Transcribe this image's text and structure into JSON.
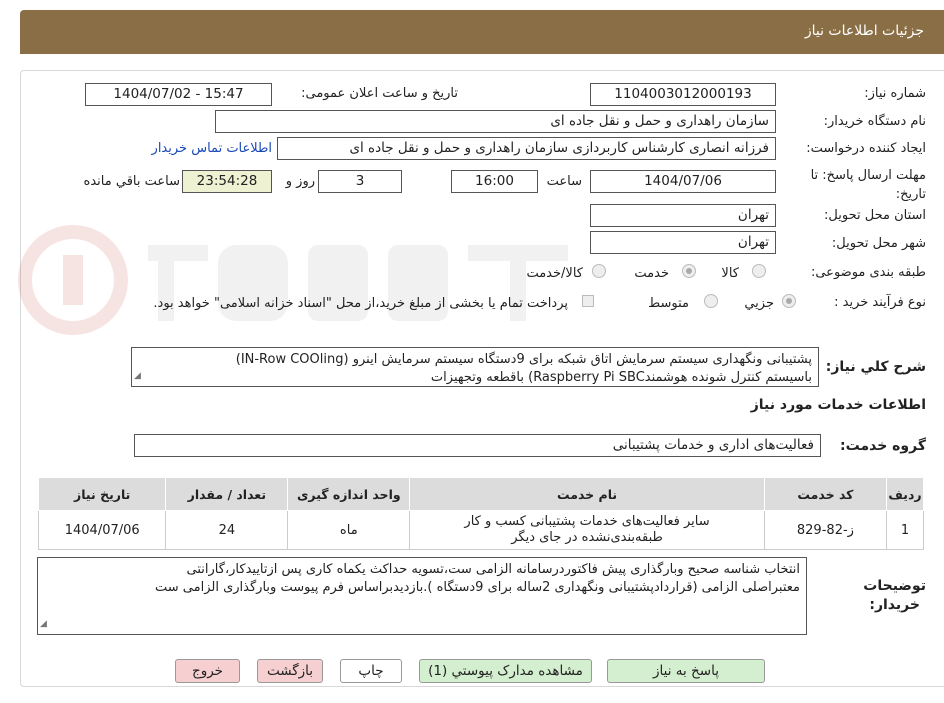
{
  "header": {
    "title": "جزئیات اطلاعات نیاز"
  },
  "fields": {
    "need_number": {
      "label": "شماره نیاز:",
      "value": "1104003012000193"
    },
    "announce_date": {
      "label": "تاریخ و ساعت اعلان عمومی:",
      "value": "1404/07/02 - 15:47"
    },
    "buyer_org": {
      "label": "نام دستگاه خریدار:",
      "value": "سازمان راهداری و حمل و نقل جاده ای"
    },
    "requester": {
      "label": "ایجاد کننده درخواست:",
      "value": "فرزانه انصاری کارشناس کاربردازی سازمان راهداری و حمل و نقل جاده ای",
      "link": "اطلاعات تماس خریدار"
    },
    "deadline": {
      "label": "مهلت ارسال پاسخ: تا تاریخ:",
      "date": "1404/07/06",
      "time_label": "ساعت",
      "time": "16:00",
      "days": "3",
      "days_label": "روز و",
      "remaining": "23:54:28",
      "remaining_label": "ساعت باقي مانده"
    },
    "province": {
      "label": "استان محل تحویل:",
      "value": "تهران"
    },
    "city": {
      "label": "شهر محل تحویل:",
      "value": "تهران"
    },
    "category": {
      "label": "طبقه بندی موضوعی:",
      "options": [
        "کالا",
        "خدمت",
        "کالا/خدمت"
      ],
      "selected": "خدمت"
    },
    "process": {
      "label": "نوع فرآیند خرید :",
      "options": [
        "جزیي",
        "متوسط"
      ],
      "selected": "جزیي",
      "note": "پرداخت تمام یا بخشی از مبلغ خرید،از محل \"اسناد خزانه اسلامی\" خواهد بود."
    }
  },
  "summary": {
    "label": "شرح کلي نیاز:",
    "line1": "پشتیبانی ونگهداری سیستم سرمایش اتاق شبکه برای 9دستگاه سیستم سرمایش اینرو (IN-Row COOling)",
    "line2": "باسیستم کنترل شونده هوشمندRaspberry Pi SBC) باقطعه وتجهیزات"
  },
  "services_section": {
    "title": "اطلاعات خدمات مورد نیاز",
    "group_label": "گروه خدمت:",
    "group_value": "فعالیت‌های اداری و خدمات پشتیبانی"
  },
  "table": {
    "headers": [
      "ردیف",
      "کد خدمت",
      "نام خدمت",
      "واحد اندازه گیری",
      "تعداد / مقدار",
      "تاریخ نیاز"
    ],
    "rows": [
      {
        "row": "1",
        "code": "ز-82-829",
        "name_line1": "سایر فعالیت‌های خدمات پشتیبانی کسب و کار",
        "name_line2": "طبقه‌بندی‌نشده در جای دیگر",
        "unit": "ماه",
        "qty": "24",
        "date": "1404/07/06"
      }
    ]
  },
  "notes": {
    "label_line1": "توضیحات",
    "label_line2": "خریدار:",
    "line1": "انتخاب شناسه صحیح وبارگذاری پیش فاکتوردرسامانه الزامی ست،تسویه حداکث یکماه کاری پس ازتاییدکار،گارانتی",
    "line2": "معتبراصلی الزامی (قراردادپشتیبانی ونگهداری 2ساله برای 9دستگاه ).بازدیدبراساس فرم پیوست وبارگذاری الزامی ست"
  },
  "buttons": {
    "reply": "پاسخ به نیاز",
    "attachments": "مشاهده مدارک پیوستي (1)",
    "print": "چاپ",
    "back": "بازگشت",
    "exit": "خروج"
  },
  "colors": {
    "header": "#8a6f46",
    "green_button": "#d4efcf",
    "pink_button": "#f6cfd0",
    "link": "#1a48b8"
  }
}
